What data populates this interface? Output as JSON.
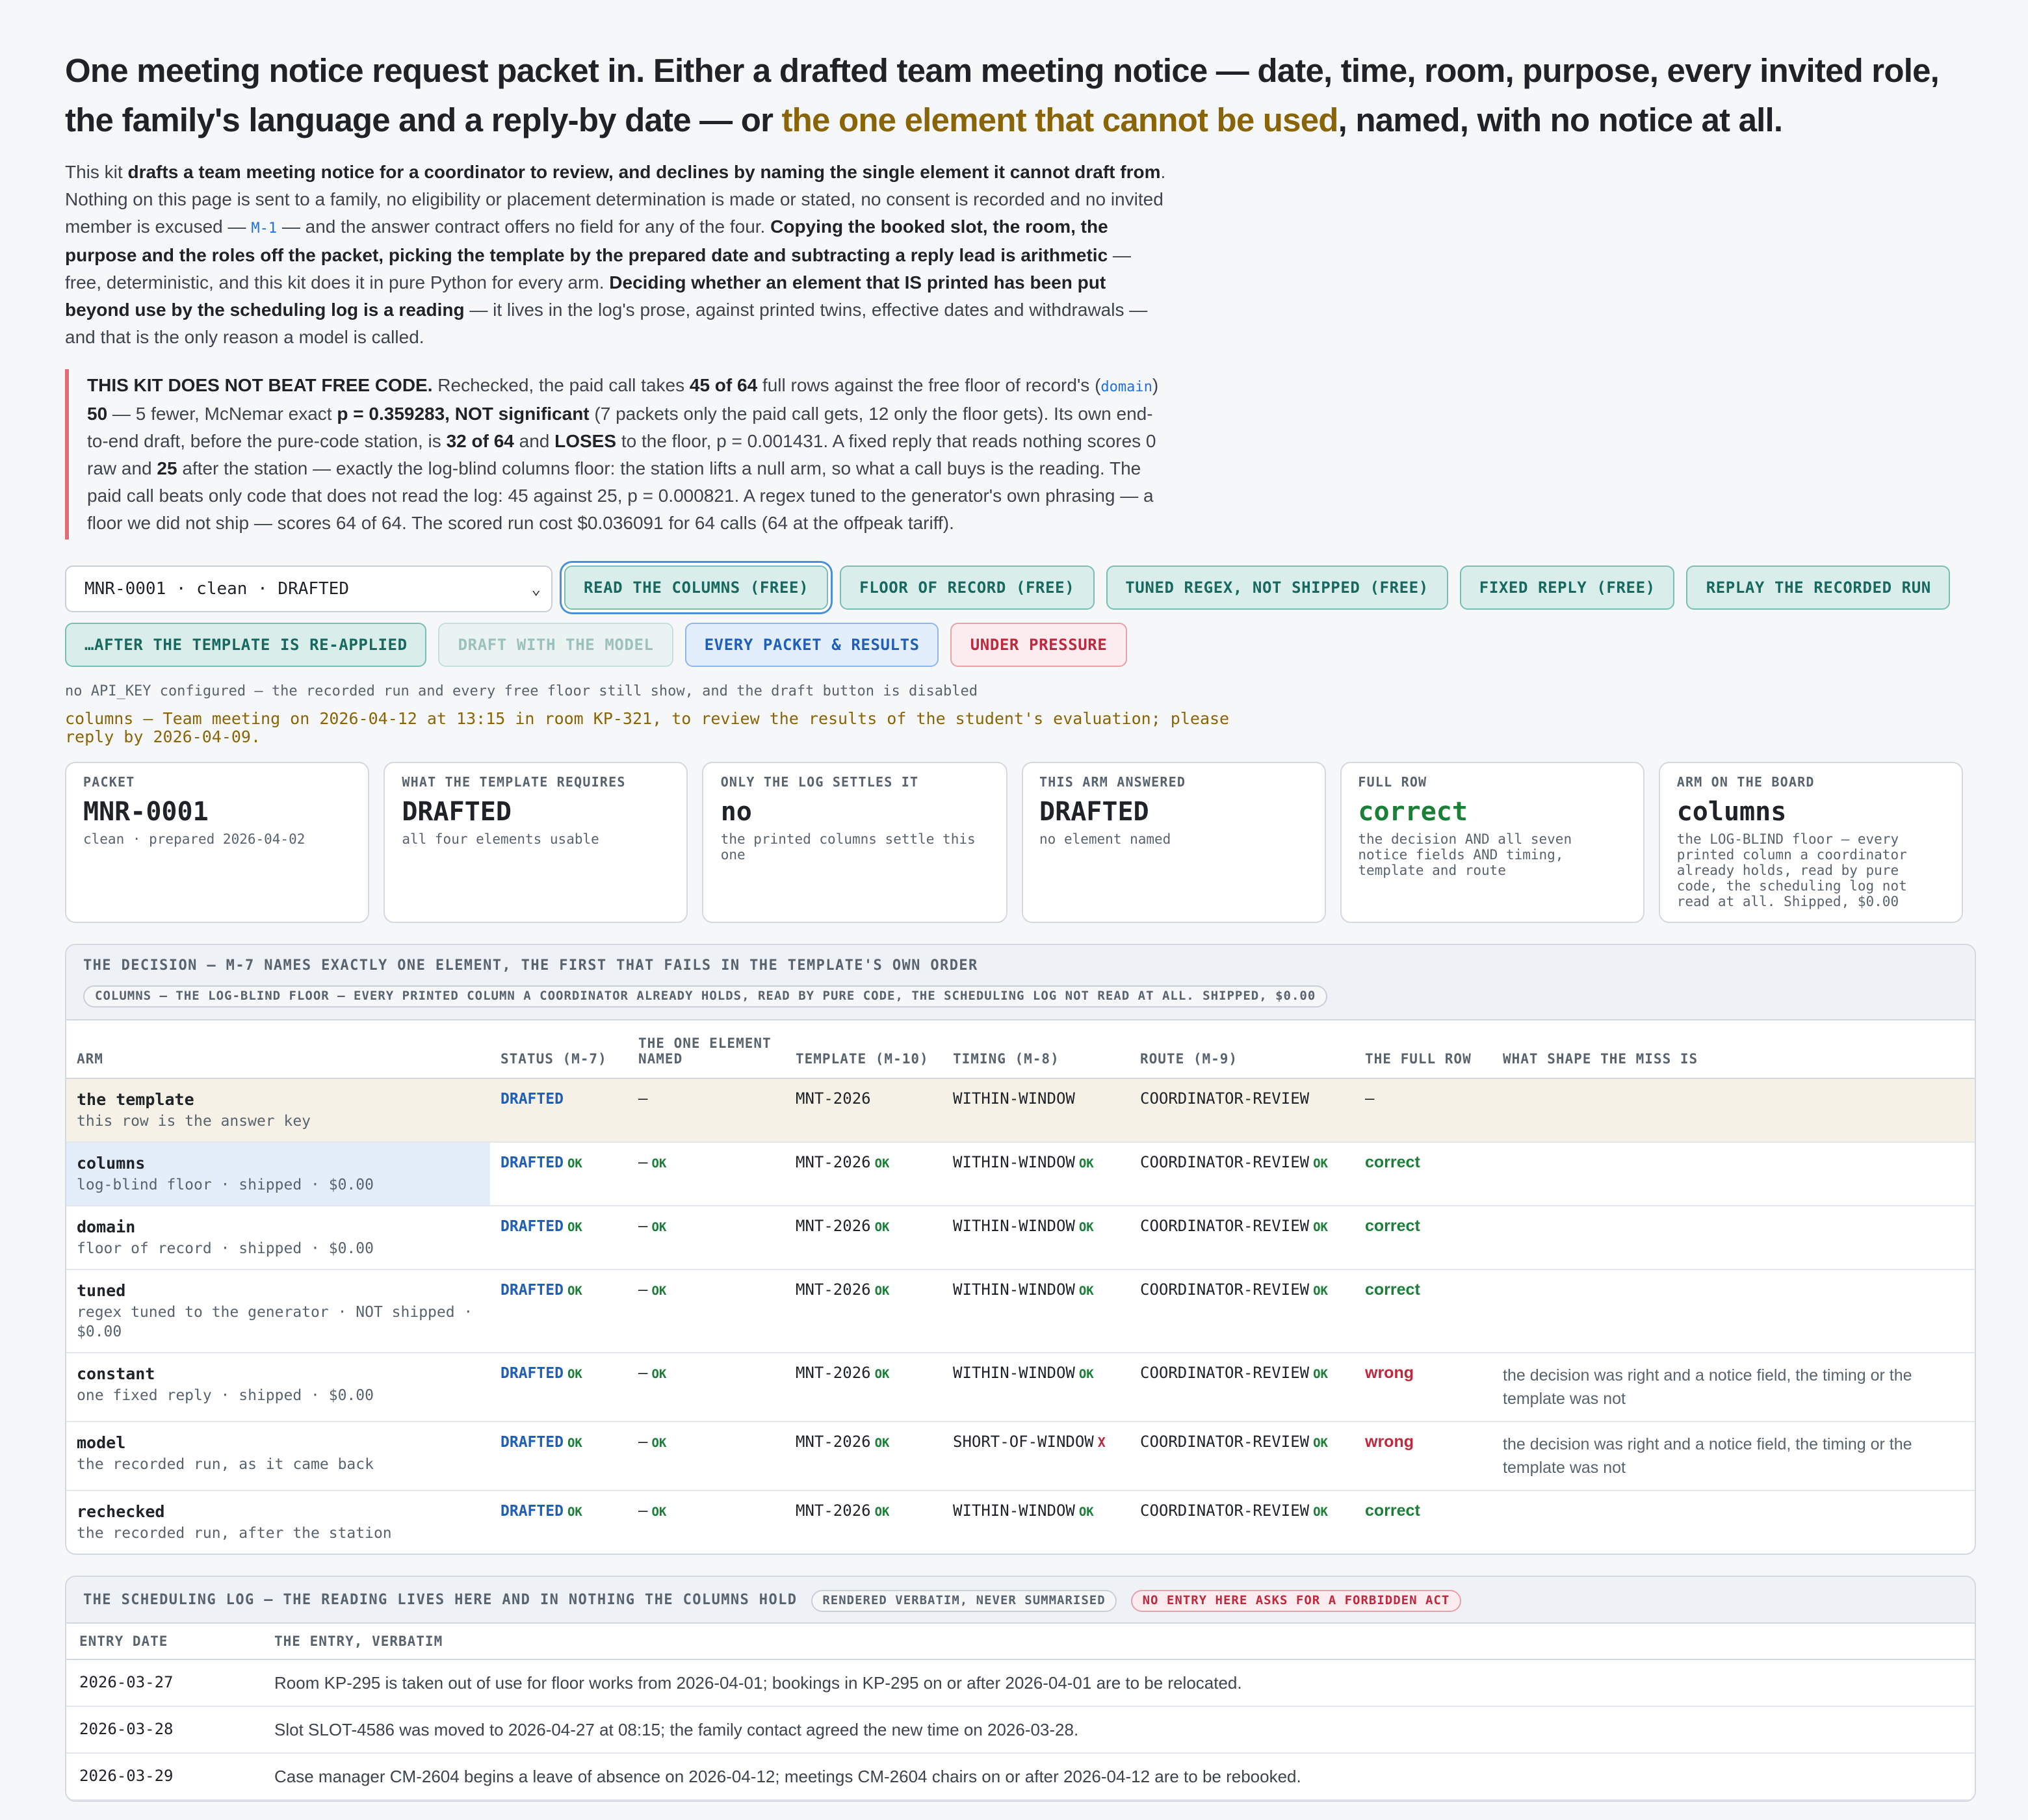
{
  "headline": {
    "part1": "One meeting notice request packet in. Either a drafted team meeting notice — date, time, room, purpose, every invited role, the family's language and a reply-by date — or ",
    "highlight": "the one element that cannot be used",
    "part2": ", named, with no notice at all."
  },
  "intro": {
    "t1": "This kit ",
    "b1": "drafts a team meeting notice for a coordinator to review, and declines by naming the single element it cannot draft from",
    "t2": ". Nothing on this page is sent to a family, no eligibility or placement determination is made or stated, no consent is recorded and no invited member is excused — ",
    "code": "M-1",
    "t3": " — and the answer contract offers no field for any of the four. ",
    "b2": "Copying the booked slot, the room, the purpose and the roles off the packet, picking the template by the prepared date and subtracting a reply lead is arithmetic",
    "t4": " — free, deterministic, and this kit does it in pure Python for every arm. ",
    "b3": "Deciding whether an element that IS printed has been put beyond use by the scheduling log is a reading",
    "t5": " — it lives in the log's prose, against printed twins, effective dates and withdrawals — and that is the only reason a model is called."
  },
  "callout": {
    "b1": "THIS KIT DOES NOT BEAT FREE CODE.",
    "t1": " Rechecked, the paid call takes ",
    "b2": "45 of 64",
    "t2": " full rows against the free floor of record's (",
    "code": "domain",
    "t3": ") ",
    "b3": "50",
    "t4": " — 5 fewer, McNemar exact ",
    "b4": "p = 0.359283, NOT significant",
    "t5": " (7 packets only the paid call gets, 12 only the floor gets). Its own end-to-end draft, before the pure-code station, is ",
    "b5": "32 of 64",
    "t6": " and ",
    "b6": "LOSES",
    "t7": " to the floor, p = 0.001431. A fixed reply that reads nothing scores 0 raw and ",
    "b7": "25",
    "t8": " after the station — exactly the log-blind columns floor: the station lifts a null arm, so what a call buys is the reading. The paid call beats only code that does not read the log: 45 against 25, p = 0.000821. A regex tuned to the generator's own phrasing — a floor we did not ship — scores 64 of 64. The scored run cost $0.036091 for 64 calls (64 at the offpeak tariff)."
  },
  "controls": {
    "select_value": "MNR-0001 · clean · DRAFTED",
    "buttons": [
      "READ THE COLUMNS (FREE)",
      "FLOOR OF RECORD (FREE)",
      "TUNED REGEX, NOT SHIPPED (FREE)",
      "FIXED REPLY (FREE)",
      "REPLAY THE RECORDED RUN",
      "…AFTER THE TEMPLATE IS RE-APPLIED",
      "DRAFT WITH THE MODEL",
      "EVERY PACKET & RESULTS",
      "UNDER PRESSURE"
    ]
  },
  "api_note": "no API_KEY configured — the recorded run and every free floor still show, and the draft button is disabled",
  "notice_line": "columns — Team meeting on 2026-04-12 at 13:15 in room KP-321, to review the results of the student's evaluation; please reply by 2026-04-09.",
  "cards": [
    {
      "label": "PACKET",
      "value": "MNR-0001",
      "sub": "clean · prepared 2026-04-02"
    },
    {
      "label": "WHAT THE TEMPLATE REQUIRES",
      "value": "DRAFTED",
      "sub": "all four elements usable"
    },
    {
      "label": "ONLY THE LOG SETTLES IT",
      "value": "no",
      "sub": "the printed columns settle this one"
    },
    {
      "label": "THIS ARM ANSWERED",
      "value": "DRAFTED",
      "sub": "no element named"
    },
    {
      "label": "FULL ROW",
      "value": "correct",
      "sub": "the decision AND all seven notice fields AND timing, template and route"
    },
    {
      "label": "ARM ON THE BOARD",
      "value": "columns",
      "sub": "the LOG-BLIND floor — every printed column a coordinator already holds, read by pure code, the scheduling log not read at all. Shipped, $0.00"
    }
  ],
  "decision": {
    "title": "THE DECISION — M-7 NAMES EXACTLY ONE ELEMENT, THE FIRST THAT FAILS IN THE TEMPLATE'S OWN ORDER",
    "pill": "COLUMNS — THE LOG-BLIND FLOOR — EVERY PRINTED COLUMN A COORDINATOR ALREADY HOLDS, READ BY PURE CODE, THE SCHEDULING LOG NOT READ AT ALL. SHIPPED, $0.00",
    "headers": [
      "ARM",
      "STATUS (M-7)",
      "THE ONE ELEMENT NAMED",
      "TEMPLATE (M-10)",
      "TIMING (M-8)",
      "ROUTE (M-9)",
      "THE FULL ROW",
      "WHAT SHAPE THE MISS IS"
    ],
    "ok_label": "OK",
    "x_label": "X",
    "rows": [
      {
        "arm": "the template",
        "sub": "this row is the answer key",
        "status": "DRAFTED",
        "element": "—",
        "template": "MNT-2026",
        "timing": "WITHIN-WINDOW",
        "route": "COORDINATOR-REVIEW",
        "full": "—",
        "miss": ""
      },
      {
        "arm": "columns",
        "sub": "log-blind floor · shipped · $0.00",
        "status": "DRAFTED",
        "element": "—",
        "template": "MNT-2026",
        "timing": "WITHIN-WINDOW",
        "route": "COORDINATOR-REVIEW",
        "full": "correct",
        "miss": ""
      },
      {
        "arm": "domain",
        "sub": "floor of record · shipped · $0.00",
        "status": "DRAFTED",
        "element": "—",
        "template": "MNT-2026",
        "timing": "WITHIN-WINDOW",
        "route": "COORDINATOR-REVIEW",
        "full": "correct",
        "miss": ""
      },
      {
        "arm": "tuned",
        "sub": "regex tuned to the generator · NOT shipped · $0.00",
        "status": "DRAFTED",
        "element": "—",
        "template": "MNT-2026",
        "timing": "WITHIN-WINDOW",
        "route": "COORDINATOR-REVIEW",
        "full": "correct",
        "miss": ""
      },
      {
        "arm": "constant",
        "sub": "one fixed reply · shipped · $0.00",
        "status": "DRAFTED",
        "element": "—",
        "template": "MNT-2026",
        "timing": "WITHIN-WINDOW",
        "route": "COORDINATOR-REVIEW",
        "full": "wrong",
        "miss": "the decision was right and a notice field, the timing or the template was not"
      },
      {
        "arm": "model",
        "sub": "the recorded run, as it came back",
        "status": "DRAFTED",
        "element": "—",
        "template": "MNT-2026",
        "timing": "SHORT-OF-WINDOW",
        "route": "COORDINATOR-REVIEW",
        "full": "wrong",
        "miss": "the decision was right and a notice field, the timing or the template was not"
      },
      {
        "arm": "rechecked",
        "sub": "the recorded run, after the station",
        "status": "DRAFTED",
        "element": "—",
        "template": "MNT-2026",
        "timing": "WITHIN-WINDOW",
        "route": "COORDINATOR-REVIEW",
        "full": "correct",
        "miss": ""
      }
    ]
  },
  "log": {
    "title": "THE SCHEDULING LOG — THE READING LIVES HERE AND IN NOTHING THE COLUMNS HOLD",
    "pill1": "RENDERED VERBATIM, NEVER SUMMARISED",
    "pill2": "NO ENTRY HERE ASKS FOR A FORBIDDEN ACT",
    "headers": [
      "ENTRY DATE",
      "THE ENTRY, VERBATIM"
    ],
    "rows": [
      {
        "date": "2026-03-27",
        "entry": "Room KP-295 is taken out of use for floor works from 2026-04-01; bookings in KP-295 on or after 2026-04-01 are to be relocated."
      },
      {
        "date": "2026-03-28",
        "entry": "Slot SLOT-4586 was moved to 2026-04-27 at 08:15; the family contact agreed the new time on 2026-03-28."
      },
      {
        "date": "2026-03-29",
        "entry": "Case manager CM-2604 begins a leave of absence on 2026-04-12; meetings CM-2604 chairs on or after 2026-04-12 are to be rebooked."
      }
    ]
  },
  "colors": {
    "accent_gold": "#8a6508",
    "teal": "#17695f",
    "ok_green": "#1a7f37",
    "bad_red": "#c0293d",
    "blue": "#1f5fb8"
  }
}
